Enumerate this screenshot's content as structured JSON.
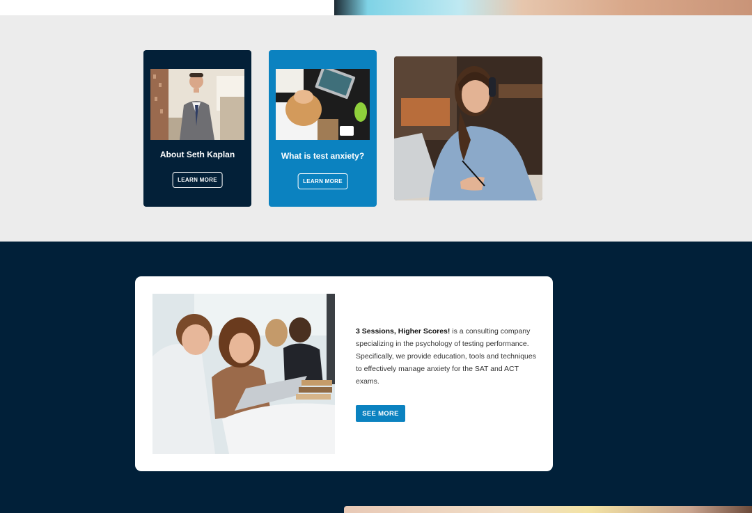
{
  "cards": [
    {
      "title": "About Seth Kaplan",
      "button": "LEARN MORE"
    },
    {
      "title": "What is test anxiety?",
      "button": "LEARN MORE"
    }
  ],
  "info": {
    "lead": "3 Sessions, Higher Scores!",
    "body": " is a consulting company specializing in the psychology of testing performance. Specifically, we provide education, tools and techniques to effectively manage anxiety for the SAT and ACT exams.",
    "button": "SEE MORE"
  },
  "colors": {
    "navy": "#032038",
    "blue": "#0b82c0",
    "gray": "#ececec"
  },
  "images": [
    "man-in-suit-photo",
    "stressed-student-photo",
    "student-with-headphones-photo",
    "students-at-laptop-photo"
  ]
}
